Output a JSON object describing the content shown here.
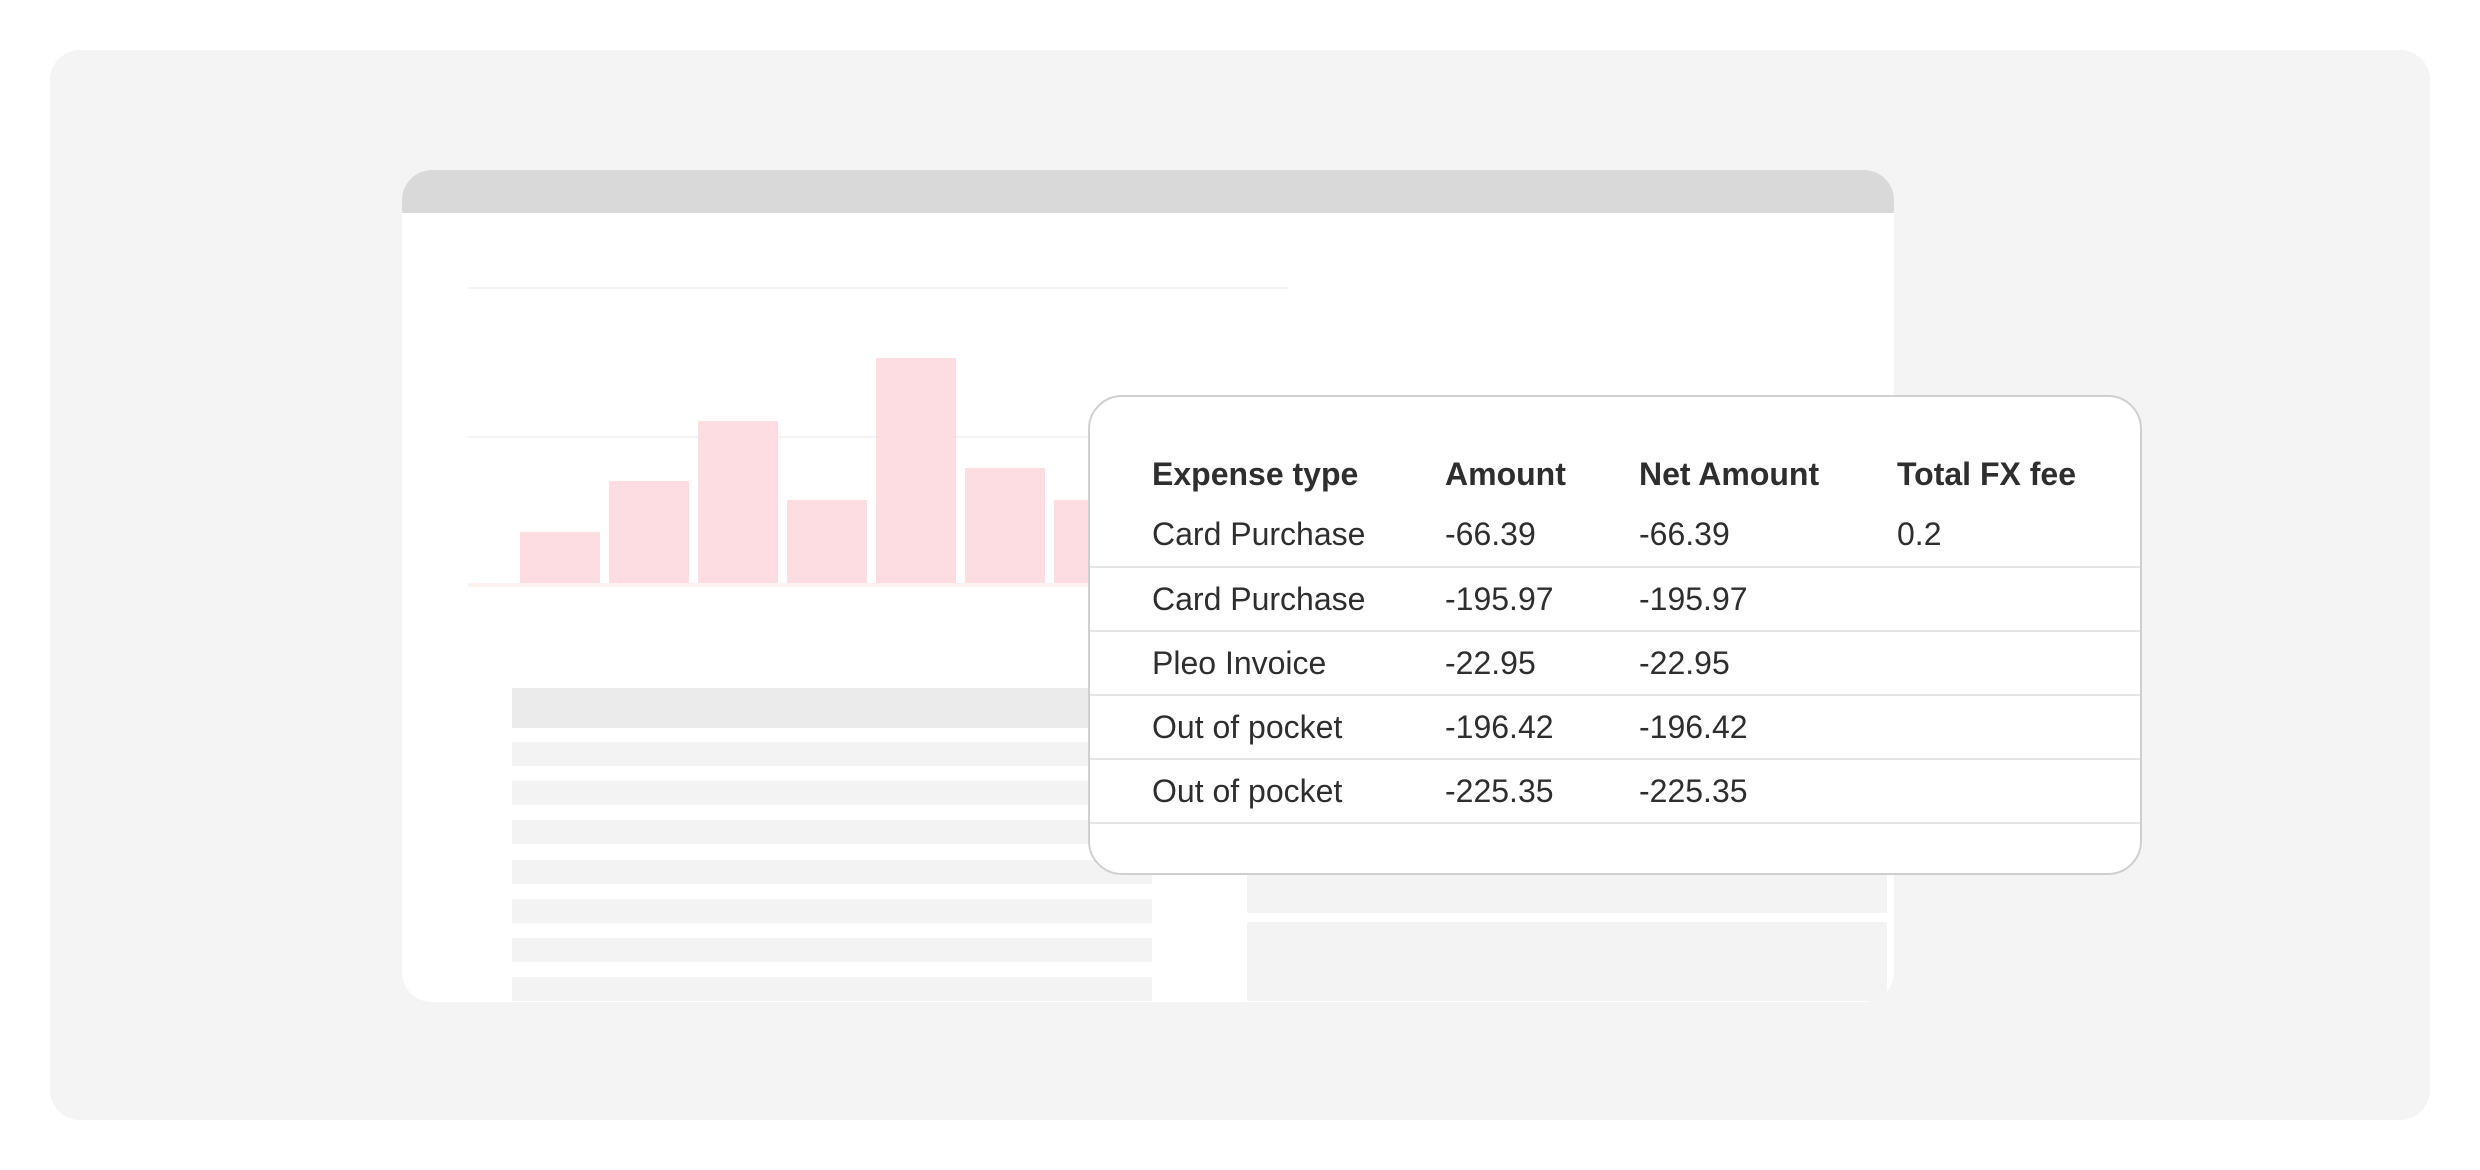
{
  "table": {
    "headers": [
      "Expense type",
      "Amount",
      "Net Amount",
      "Total FX fee"
    ],
    "rows": [
      {
        "expense_type": "Card Purchase",
        "amount": "-66.39",
        "net_amount": "-66.39",
        "total_fx_fee": "0.2"
      },
      {
        "expense_type": "Card Purchase",
        "amount": "-195.97",
        "net_amount": "-195.97",
        "total_fx_fee": ""
      },
      {
        "expense_type": "Pleo Invoice",
        "amount": "-22.95",
        "net_amount": "-22.95",
        "total_fx_fee": ""
      },
      {
        "expense_type": "Out of pocket",
        "amount": "-196.42",
        "net_amount": "-196.42",
        "total_fx_fee": ""
      },
      {
        "expense_type": "Out of pocket",
        "amount": "-225.35",
        "net_amount": "-225.35",
        "total_fx_fee": ""
      }
    ]
  },
  "colors": {
    "stage_bg": "#f4f4f4",
    "bar_fill": "#fddde1",
    "skeleton": "#f3f3f3",
    "text": "#2e2e2e"
  }
}
